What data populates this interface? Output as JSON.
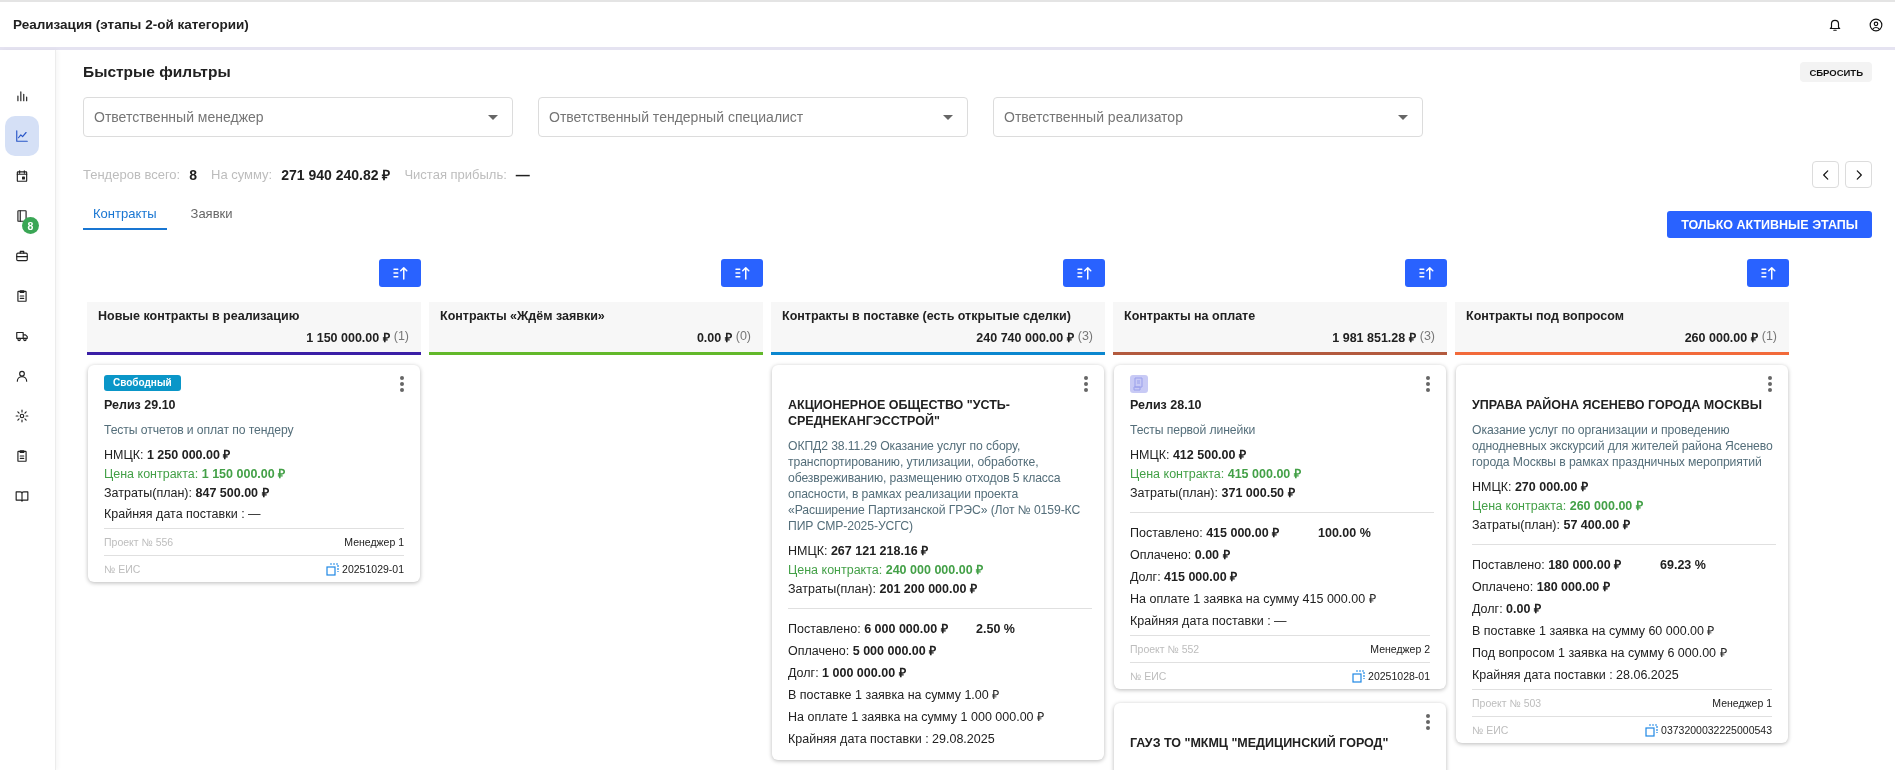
{
  "header": {
    "title": "Реализация (этапы 2-ой категории)"
  },
  "sidebar": {
    "items": [
      {
        "selected": false
      },
      {
        "selected": true
      },
      {
        "selected": false
      },
      {
        "selected": false,
        "badge": "8"
      },
      {
        "selected": false
      },
      {
        "selected": false
      },
      {
        "selected": false
      },
      {
        "selected": false
      },
      {
        "selected": false
      },
      {
        "selected": false
      },
      {
        "selected": false
      }
    ]
  },
  "filters": {
    "title": "Быстрые фильтры",
    "reset": "СБРОСИТЬ",
    "fields": [
      {
        "placeholder": "Ответственный менеджер"
      },
      {
        "placeholder": "Ответственный тендерный специалист"
      },
      {
        "placeholder": "Ответственный реализатор"
      }
    ]
  },
  "stats": [
    {
      "label": "Тендеров всего:",
      "value": "8"
    },
    {
      "label": "На сумму:",
      "value": "271 940 240.82 ₽"
    },
    {
      "label": "Чистая прибыль:",
      "value": "—"
    }
  ],
  "tabs": [
    {
      "label": "Контракты",
      "selected": true
    },
    {
      "label": "Заявки",
      "selected": false
    }
  ],
  "active_only_button": "ТОЛЬКО АКТИВНЫЕ ЭТАПЫ",
  "columns": [
    {
      "title": "Новые контракты в реализацию",
      "total": "1 150 000.00 ₽",
      "count": "(1)",
      "color": "#3a1fa6",
      "cards": [
        {
          "header": {
            "kind": "badge",
            "label": "Свободный"
          },
          "title": "Релиз 29.10",
          "description": "Тесты отчетов и оплат по тендеру",
          "sections": [
            [
              {
                "kind": "amount",
                "label": "НМЦК:",
                "value": "1 250 000.00 ₽"
              },
              {
                "kind": "price",
                "label": "Цена контракта:",
                "value": "1 150 000.00 ₽"
              },
              {
                "kind": "amount",
                "label": "Затраты(план):",
                "value": "847 500.00 ₽"
              },
              {
                "kind": "note",
                "text": "Крайняя дата поставки : —"
              }
            ]
          ],
          "project": "Проект № 556",
          "manager": "Менеджер 1",
          "eis_label": "№ ЕИС",
          "eis": "20251029-01"
        }
      ]
    },
    {
      "title": "Контракты «Ждём заявки»",
      "total": "0.00 ₽",
      "count": "(0)",
      "color": "#62b82a"
    },
    {
      "title": "Контракты в поставке (есть открытые сделки)",
      "total": "240 740 000.00 ₽",
      "count": "(3)",
      "color": "#0b87cf",
      "cards": [
        {
          "title": "АКЦИОНЕРНОЕ ОБЩЕСТВО \"УСТЬ-СРЕДНЕКАНГЭССТРОЙ\"",
          "description": "ОКПД2 38.11.29 Оказание услуг по сбору, транспортированию, утилизации, обработке, обезвреживанию, размещению отходов 5 класса опасности, в рамках реализации проекта «Расширение Партизанской ГРЭС» (Лот № 0159-КС ПИР СМР-2025-УСГС)",
          "sections": [
            [
              {
                "kind": "amount",
                "label": "НМЦК:",
                "value": "267 121 218.16 ₽"
              },
              {
                "kind": "price",
                "label": "Цена контракта:",
                "value": "240 000 000.00 ₽"
              },
              {
                "kind": "amount",
                "label": "Затраты(план):",
                "value": "201 200 000.00 ₽"
              }
            ],
            [
              {
                "kind": "amount",
                "label": "Поставлено:",
                "value": "6 000 000.00 ₽",
                "percent": "2.50 %"
              },
              {
                "kind": "amount",
                "label": "Оплачено:",
                "value": "5 000 000.00 ₽"
              },
              {
                "kind": "amount",
                "label": "Долг:",
                "value": "1 000 000.00 ₽"
              },
              {
                "kind": "note",
                "text": "В поставке 1 заявка на сумму 1.00 ₽"
              },
              {
                "kind": "note",
                "text": "На оплате 1 заявка на сумму 1 000 000.00 ₽"
              },
              {
                "kind": "note",
                "text": "Крайняя дата поставки : 29.08.2025"
              }
            ]
          ]
        }
      ]
    },
    {
      "title": "Контракты на оплате",
      "total": "1 981 851.28 ₽",
      "count": "(3)",
      "color": "#b35a3e",
      "cards": [
        {
          "header": {
            "kind": "icon"
          },
          "title": "Релиз 28.10",
          "description": "Тесты первой линейки",
          "sections": [
            [
              {
                "kind": "amount",
                "label": "НМЦК:",
                "value": "412 500.00 ₽"
              },
              {
                "kind": "price",
                "label": "Цена контракта:",
                "value": "415 000.00 ₽"
              },
              {
                "kind": "amount",
                "label": "Затраты(план):",
                "value": "371 000.50 ₽"
              }
            ],
            [
              {
                "kind": "amount",
                "label": "Поставлено:",
                "value": "415 000.00 ₽",
                "percent": "100.00 %"
              },
              {
                "kind": "amount",
                "label": "Оплачено:",
                "value": "0.00 ₽"
              },
              {
                "kind": "amount",
                "label": "Долг:",
                "value": "415 000.00 ₽"
              },
              {
                "kind": "note",
                "text": "На оплате 1 заявка на сумму 415 000.00 ₽"
              },
              {
                "kind": "note",
                "text": "Крайняя дата поставки : —"
              }
            ]
          ],
          "project": "Проект № 552",
          "manager": "Менеджер 2",
          "eis_label": "№ ЕИС",
          "eis": "20251028-01"
        },
        {
          "title": "ГАУЗ ТО \"МКМЦ \"МЕДИЦИНСКИЙ ГОРОД\""
        }
      ]
    },
    {
      "title": "Контракты под вопросом",
      "total": "260 000.00 ₽",
      "count": "(1)",
      "color": "#f26a3a",
      "cards": [
        {
          "title": "УПРАВА РАЙОНА ЯСЕНЕВО ГОРОДА МОСКВЫ",
          "description": "Оказание услуг по организации и проведению однодневных экскурсий для жителей района Ясенево города Москвы в рамках праздничных мероприятий",
          "sections": [
            [
              {
                "kind": "amount",
                "label": "НМЦК:",
                "value": "270 000.00 ₽"
              },
              {
                "kind": "price",
                "label": "Цена контракта:",
                "value": "260 000.00 ₽"
              },
              {
                "kind": "amount",
                "label": "Затраты(план):",
                "value": "57 400.00 ₽"
              }
            ],
            [
              {
                "kind": "amount",
                "label": "Поставлено:",
                "value": "180 000.00 ₽",
                "percent": "69.23 %"
              },
              {
                "kind": "amount",
                "label": "Оплачено:",
                "value": "180 000.00 ₽"
              },
              {
                "kind": "amount",
                "label": "Долг:",
                "value": "0.00 ₽"
              },
              {
                "kind": "note",
                "text": "В поставке 1 заявка на сумму 60 000.00 ₽"
              },
              {
                "kind": "note",
                "text": "Под вопросом 1 заявка на сумму 6 000.00 ₽"
              },
              {
                "kind": "note",
                "text": "Крайняя дата поставки : 28.06.2025"
              }
            ]
          ],
          "project": "Проект № 503",
          "manager": "Менеджер 1",
          "eis_label": "№ ЕИС",
          "eis": "0373200032225000543"
        }
      ]
    }
  ]
}
